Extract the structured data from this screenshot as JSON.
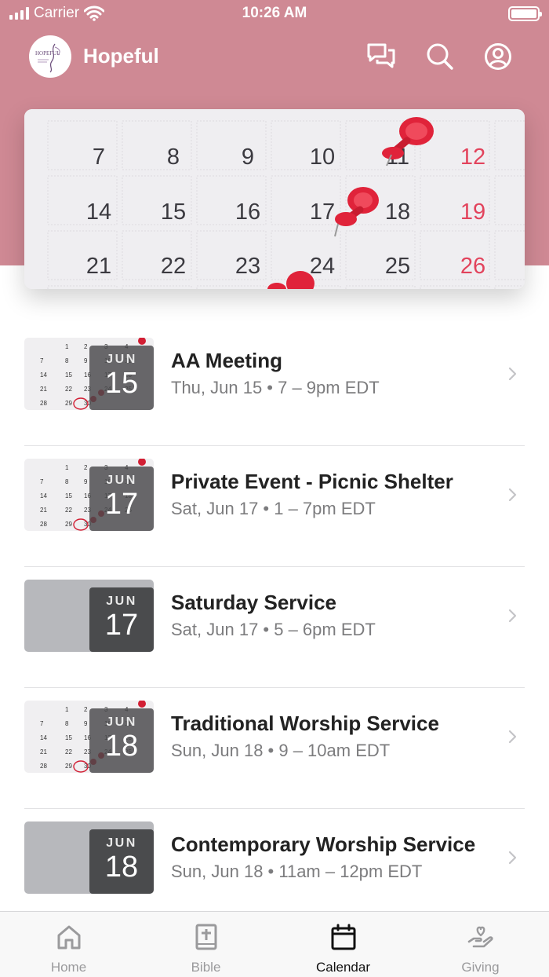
{
  "status_bar": {
    "carrier": "Carrier",
    "time": "10:26 AM"
  },
  "header": {
    "title": "Hopeful",
    "logo_text": "HOPEFUL",
    "color": "#cf8994"
  },
  "hero": {
    "calendar_rows": [
      [
        "7",
        "8",
        "9",
        "10",
        "11",
        "12"
      ],
      [
        "14",
        "15",
        "16",
        "17",
        "18",
        "19"
      ],
      [
        "21",
        "22",
        "23",
        "24",
        "25",
        "26"
      ]
    ]
  },
  "events": [
    {
      "month": "JUN",
      "day": "15",
      "title": "AA Meeting",
      "subtitle": "Thu, Jun 15 • 7 – 9pm EDT",
      "thumb": "calendar-photo"
    },
    {
      "month": "JUN",
      "day": "17",
      "title": "Private Event - Picnic Shelter",
      "subtitle": "Sat, Jun 17 • 1 – 7pm EDT",
      "thumb": "calendar-photo"
    },
    {
      "month": "JUN",
      "day": "17",
      "title": "Saturday Service",
      "subtitle": "Sat, Jun 17 • 5 – 6pm EDT",
      "thumb": "plain-gray"
    },
    {
      "month": "JUN",
      "day": "18",
      "title": "Traditional Worship Service",
      "subtitle": "Sun, Jun 18 • 9 – 10am EDT",
      "thumb": "calendar-photo"
    },
    {
      "month": "JUN",
      "day": "18",
      "title": "Contemporary Worship Service",
      "subtitle": "Sun, Jun 18 • 11am – 12pm EDT",
      "thumb": "plain-gray"
    }
  ],
  "tab_bar": {
    "tabs": [
      {
        "label": "Home",
        "icon": "home-icon",
        "active": false
      },
      {
        "label": "Bible",
        "icon": "bible-icon",
        "active": false
      },
      {
        "label": "Calendar",
        "icon": "calendar-icon",
        "active": true
      },
      {
        "label": "Giving",
        "icon": "giving-icon",
        "active": false
      }
    ]
  }
}
